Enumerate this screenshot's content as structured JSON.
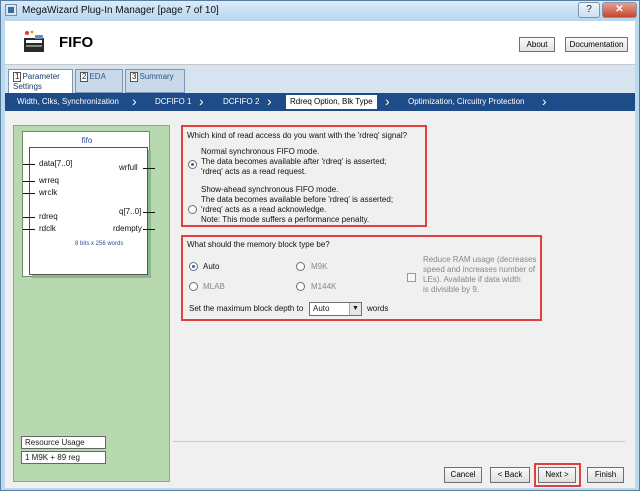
{
  "window": {
    "title": "MegaWizard Plug-In Manager [page 7 of 10]",
    "help_label": "?",
    "close_label": "✕"
  },
  "header": {
    "title": "FIFO",
    "about_label": "About",
    "documentation_label": "Documentation"
  },
  "tabs": [
    {
      "num": "1",
      "label": "Parameter",
      "label2": "Settings"
    },
    {
      "num": "2",
      "label": "EDA"
    },
    {
      "num": "3",
      "label": "Summary"
    }
  ],
  "steps": [
    "Width, Clks, Synchronization",
    "DCFIFO 1",
    "DCFIFO 2",
    "Rdreq Option, Blk Type",
    "Optimization, Circuitry Protection"
  ],
  "symbol": {
    "name": "fifo",
    "pins_left": [
      "data[7..0]",
      "wrreq",
      "wrclk",
      "rdreq",
      "rdclk"
    ],
    "pins_right": [
      "wrfull",
      "q[7..0]",
      "rdempty"
    ],
    "note": "8 bits x 256 words"
  },
  "resource": {
    "label": "Resource Usage",
    "value": "1 M9K + 89 reg"
  },
  "read_access": {
    "question": "Which kind of read access do you want with the 'rdreq' signal?",
    "option1": [
      "Normal synchronous FIFO mode.",
      "The data becomes available after 'rdreq' is asserted;",
      "'rdreq' acts as a read request."
    ],
    "option2": [
      "Show-ahead synchronous FIFO mode.",
      "The data becomes available before 'rdreq' is asserted;",
      "'rdreq' acts as a read acknowledge.",
      "Note: This mode suffers a performance penalty."
    ],
    "selected": "option1"
  },
  "memory_block": {
    "question": "What should the memory block type be?",
    "options": [
      "Auto",
      "M9K",
      "MLAB",
      "M144K"
    ],
    "selected": "Auto",
    "reduce_ram": [
      "Reduce RAM usage (decreases",
      "speed and increases number of",
      "LEs).  Available if data width",
      "is divisible by 9."
    ],
    "depth_label": "Set the maximum block depth to",
    "depth_value": "Auto",
    "depth_unit": "words"
  },
  "footer": {
    "cancel": "Cancel",
    "back": "< Back",
    "next": "Next >",
    "finish": "Finish"
  }
}
